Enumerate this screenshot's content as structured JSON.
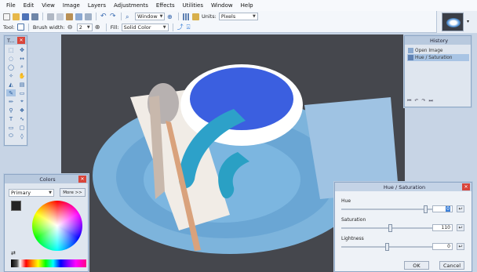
{
  "menu": [
    "File",
    "Edit",
    "View",
    "Image",
    "Layers",
    "Adjustments",
    "Effects",
    "Utilities",
    "Window",
    "Help"
  ],
  "toolbar": {
    "zoom_select": "Window",
    "units_label": "Units:",
    "units_value": "Pixels",
    "tool_label": "Tool:",
    "brush_width_label": "Brush width:",
    "brush_width_value": "2",
    "fill_label": "Fill:",
    "fill_value": "Solid Color"
  },
  "tools_window": {
    "title": "T..."
  },
  "history": {
    "title": "History",
    "items": [
      {
        "label": "Open Image",
        "selected": false
      },
      {
        "label": "Hue / Saturation",
        "selected": true
      }
    ]
  },
  "colors_window": {
    "title": "Colors",
    "mode": "Primary",
    "more_button": "More >>"
  },
  "hue_dialog": {
    "title": "Hue / Saturation",
    "hue_label": "Hue",
    "hue_value": "0",
    "saturation_label": "Saturation",
    "saturation_value": "110",
    "lightness_label": "Lightness",
    "lightness_value": "0",
    "ok": "OK",
    "cancel": "Cancel"
  },
  "colors": {
    "accent": "#3b7fd8",
    "close": "#d9453a"
  }
}
